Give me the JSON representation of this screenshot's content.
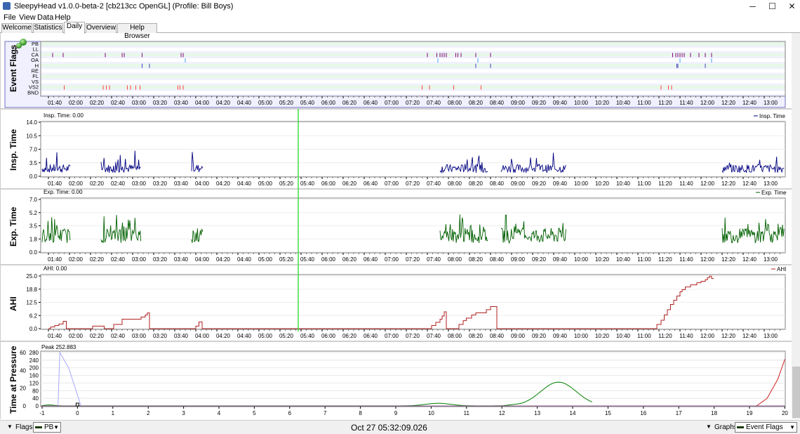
{
  "window": {
    "title": "SleepyHead v1.0.0-beta-2 [cb213cc OpenGL] (Profile: Bill Boys)",
    "min_glyph": "─",
    "max_glyph": "☐",
    "close_glyph": "✕"
  },
  "menu": [
    "File",
    "View",
    "Data",
    "Help"
  ],
  "tabs": [
    {
      "label": "Welcome",
      "active": false
    },
    {
      "label": "Statistics",
      "active": false
    },
    {
      "label": "Daily",
      "active": true
    },
    {
      "label": "Overview",
      "active": false
    },
    {
      "label": "Help Browser",
      "active": false
    }
  ],
  "time_ticks": [
    "01:40",
    "02:00",
    "02:20",
    "02:40",
    "03:00",
    "03:20",
    "03:40",
    "04:00",
    "04:20",
    "04:40",
    "05:00",
    "05:20",
    "05:40",
    "06:00",
    "06:20",
    "06:40",
    "07:00",
    "07:20",
    "07:40",
    "08:00",
    "08:20",
    "08:40",
    "09:00",
    "09:20",
    "09:40",
    "10:00",
    "10:20",
    "10:40",
    "11:00",
    "11:20",
    "11:40",
    "12:00",
    "12:20",
    "12:40",
    "13:00"
  ],
  "event_flags": {
    "title": "Event Flags",
    "rows": [
      "PB",
      "LL",
      "CA",
      "OA",
      "H",
      "RE",
      "FL",
      "VS",
      "VS2",
      "BND"
    ],
    "colors": {
      "CA": "#800080",
      "OA": "#40a0ff",
      "H": "#4040c0",
      "VS": "#ff4040",
      "VS2": "#ff4040"
    },
    "events_minutes": {
      "CA": [
        4,
        14,
        54,
        70,
        72,
        89,
        126,
        128,
        360,
        369,
        372,
        374,
        376,
        378,
        387,
        389,
        392,
        406,
        420,
        593,
        596,
        598,
        600,
        602,
        604,
        610,
        618,
        624,
        630
      ],
      "OA": [
        130,
        370,
        408,
        600,
        630
      ],
      "H": [
        89,
        96,
        406,
        420,
        597,
        598,
        624
      ],
      "VS2": [
        15,
        52,
        55,
        58,
        75,
        78,
        83,
        87,
        123,
        125,
        128,
        355,
        362,
        385,
        411,
        582,
        589,
        592
      ]
    }
  },
  "insp_time": {
    "title": "Insp. Time",
    "readout": "Insp. Time: 0.00",
    "legend": "Insp. Time",
    "yticks": [
      "14.0",
      "10.5",
      "7.0",
      "3.5",
      "0.0"
    ],
    "ymax": 14,
    "color": "#000080"
  },
  "exp_time": {
    "title": "Exp. Time",
    "readout": "Exp. Time: 0.00",
    "legend": "Exp. Time",
    "yticks": [
      "7.0",
      "5.2",
      "3.5",
      "1.8",
      "0.0"
    ],
    "ymax": 7,
    "color": "#006000"
  },
  "ahi": {
    "title": "AHI",
    "readout": "AHI: 0.00",
    "legend": "AHI",
    "yticks": [
      "25.0",
      "18.8",
      "12.5",
      "6.2",
      "0.0"
    ],
    "ymax": 25,
    "color": "#b02020",
    "steps": [
      [
        0,
        0
      ],
      [
        2,
        0
      ],
      [
        2,
        0.8
      ],
      [
        6,
        0.8
      ],
      [
        6,
        1.5
      ],
      [
        10,
        1.5
      ],
      [
        10,
        2.2
      ],
      [
        14,
        2.2
      ],
      [
        14,
        3.5
      ],
      [
        17,
        3.5
      ],
      [
        17,
        0
      ],
      [
        42,
        0
      ],
      [
        42,
        1.2
      ],
      [
        53,
        1.2
      ],
      [
        53,
        0
      ],
      [
        62,
        0
      ],
      [
        62,
        2.0
      ],
      [
        70,
        2.0
      ],
      [
        70,
        4.5
      ],
      [
        88,
        4.5
      ],
      [
        88,
        5.5
      ],
      [
        92,
        5.5
      ],
      [
        92,
        6.5
      ],
      [
        94,
        6.5
      ],
      [
        94,
        7.5
      ],
      [
        96,
        7.5
      ],
      [
        96,
        0
      ],
      [
        140,
        0
      ],
      [
        140,
        1.2
      ],
      [
        143,
        1.2
      ],
      [
        143,
        3.2
      ],
      [
        146,
        3.2
      ],
      [
        146,
        0
      ],
      [
        360,
        0
      ],
      [
        360,
        0
      ],
      [
        364,
        0
      ],
      [
        364,
        1.5
      ],
      [
        368,
        1.5
      ],
      [
        368,
        3.0
      ],
      [
        372,
        3.0
      ],
      [
        372,
        4.5
      ],
      [
        374,
        4.5
      ],
      [
        374,
        6.0
      ],
      [
        376,
        6.0
      ],
      [
        376,
        8.0
      ],
      [
        378,
        8.0
      ],
      [
        378,
        0
      ],
      [
        390,
        0
      ],
      [
        390,
        2.0
      ],
      [
        394,
        2.0
      ],
      [
        394,
        3.8
      ],
      [
        397,
        3.8
      ],
      [
        397,
        5.0
      ],
      [
        402,
        5.0
      ],
      [
        402,
        6.5
      ],
      [
        406,
        6.5
      ],
      [
        406,
        7.5
      ],
      [
        416,
        7.5
      ],
      [
        416,
        9.0
      ],
      [
        420,
        9.0
      ],
      [
        420,
        10.5
      ],
      [
        426,
        10.5
      ],
      [
        426,
        0
      ],
      [
        578,
        0
      ],
      [
        578,
        2.0
      ],
      [
        582,
        2.0
      ],
      [
        582,
        4.0
      ],
      [
        585,
        4.0
      ],
      [
        585,
        6.5
      ],
      [
        588,
        6.5
      ],
      [
        588,
        9.0
      ],
      [
        591,
        9.0
      ],
      [
        591,
        11.5
      ],
      [
        594,
        11.5
      ],
      [
        594,
        13.5
      ],
      [
        597,
        13.5
      ],
      [
        597,
        15.5
      ],
      [
        600,
        15.5
      ],
      [
        600,
        17.5
      ],
      [
        602,
        17.5
      ],
      [
        602,
        18.5
      ],
      [
        605,
        18.5
      ],
      [
        605,
        19.8
      ],
      [
        610,
        19.8
      ],
      [
        610,
        20.8
      ],
      [
        616,
        20.8
      ],
      [
        616,
        21.8
      ],
      [
        620,
        21.8
      ],
      [
        620,
        22.5
      ],
      [
        624,
        22.5
      ],
      [
        624,
        23.2
      ],
      [
        626,
        23.2
      ],
      [
        626,
        24.2
      ],
      [
        628,
        24.2
      ],
      [
        628,
        24.9
      ],
      [
        630,
        24.9
      ],
      [
        630,
        23.8
      ],
      [
        632,
        23.8
      ]
    ]
  },
  "pressure": {
    "title": "Time at Pressure",
    "readout": "Peak 252.883",
    "yticks": [
      "280",
      "240",
      "200",
      "160",
      "120",
      "80",
      "40",
      "0"
    ],
    "yticks_left": [
      "60",
      "40",
      "20",
      "0"
    ],
    "xticks": [
      "-1",
      "0",
      "1",
      "2",
      "3",
      "4",
      "5",
      "6",
      "7",
      "8",
      "9",
      "10",
      "11",
      "12",
      "13",
      "14",
      "15",
      "16",
      "17",
      "18",
      "19",
      "20"
    ]
  },
  "bottom": {
    "flags_label": "Flags",
    "flags_combo": "PB",
    "date": "Oct 27 05:32:09.026",
    "graphs_label": "Graphs",
    "graphs_combo": "Event Flags"
  },
  "colors": {
    "accent_green": "#4caf50",
    "cursor_line": "#40e040",
    "flag_stripe": "#e8f8e8"
  }
}
